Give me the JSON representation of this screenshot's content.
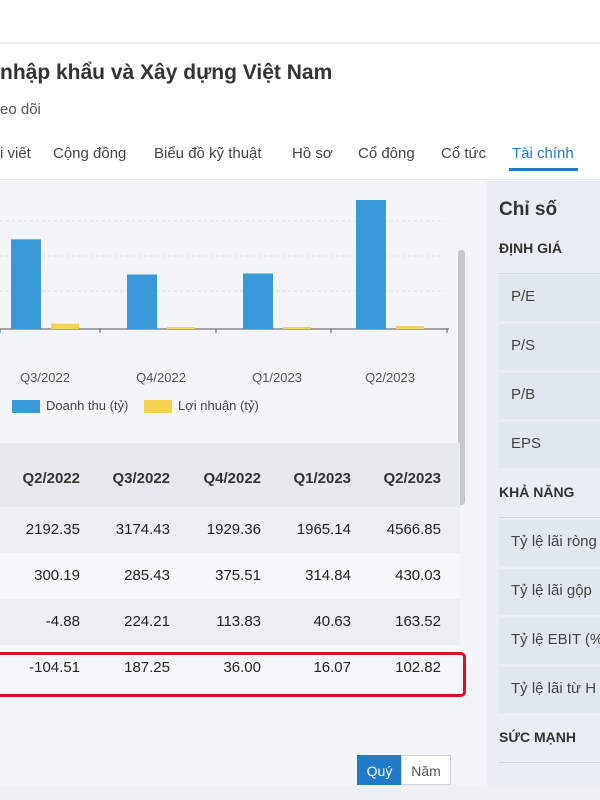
{
  "company_title": "nhập khẩu và Xây dựng Việt Nam",
  "follow_text": "eo dõi",
  "tabs": [
    {
      "label": "i viết"
    },
    {
      "label": "Cộng đồng"
    },
    {
      "label": "Biểu đồ kỹ thuật"
    },
    {
      "label": "Hồ sơ"
    },
    {
      "label": "Cổ đông"
    },
    {
      "label": "Cổ tức"
    },
    {
      "label": "Tài chính",
      "active": true
    }
  ],
  "colors": {
    "accent": "#1f7ac8",
    "revenue": "#3a9ad9",
    "profit": "#f7d154",
    "highlight": "#d9102a"
  },
  "chart_data": {
    "type": "bar",
    "categories": [
      "Q3/2022",
      "Q4/2022",
      "Q1/2023",
      "Q2/2023"
    ],
    "series": [
      {
        "name": "Doanh thu (tỷ)",
        "values": [
          3174.43,
          1929.36,
          1965.14,
          4566.85
        ]
      },
      {
        "name": "Lợi nhuận (tỷ)",
        "values": [
          187.25,
          36.0,
          16.07,
          102.82
        ]
      }
    ],
    "grid": true,
    "legend": "bottom-left"
  },
  "table": {
    "headers": [
      "Q2/2022",
      "Q3/2022",
      "Q4/2022",
      "Q1/2023",
      "Q2/2023"
    ],
    "rows": [
      [
        "2192.35",
        "3174.43",
        "1929.36",
        "1965.14",
        "4566.85"
      ],
      [
        "300.19",
        "285.43",
        "375.51",
        "314.84",
        "430.03"
      ],
      [
        "-4.88",
        "224.21",
        "113.83",
        "40.63",
        "163.52"
      ],
      [
        "-104.51",
        "187.25",
        "36.00",
        "16.07",
        "102.82"
      ]
    ]
  },
  "toggle": {
    "quarter": "Quý",
    "year": "Năm"
  },
  "sidebar": {
    "title": "Chỉ số",
    "rows": [
      {
        "type": "section",
        "label": "ĐỊNH GIÁ"
      },
      {
        "type": "item",
        "label": "P/E"
      },
      {
        "type": "item",
        "label": "P/S"
      },
      {
        "type": "item",
        "label": "P/B"
      },
      {
        "type": "item",
        "label": "EPS"
      },
      {
        "type": "section",
        "label": "KHẢ NĂNG"
      },
      {
        "type": "item",
        "label": "Tỷ lệ lãi ròng"
      },
      {
        "type": "item",
        "label": "Tỷ lệ lãi gộp"
      },
      {
        "type": "item",
        "label": "Tỷ lệ EBIT (%"
      },
      {
        "type": "item",
        "label": "Tỷ lệ lãi từ H"
      },
      {
        "type": "section",
        "label": "SỨC MẠNH"
      }
    ]
  }
}
